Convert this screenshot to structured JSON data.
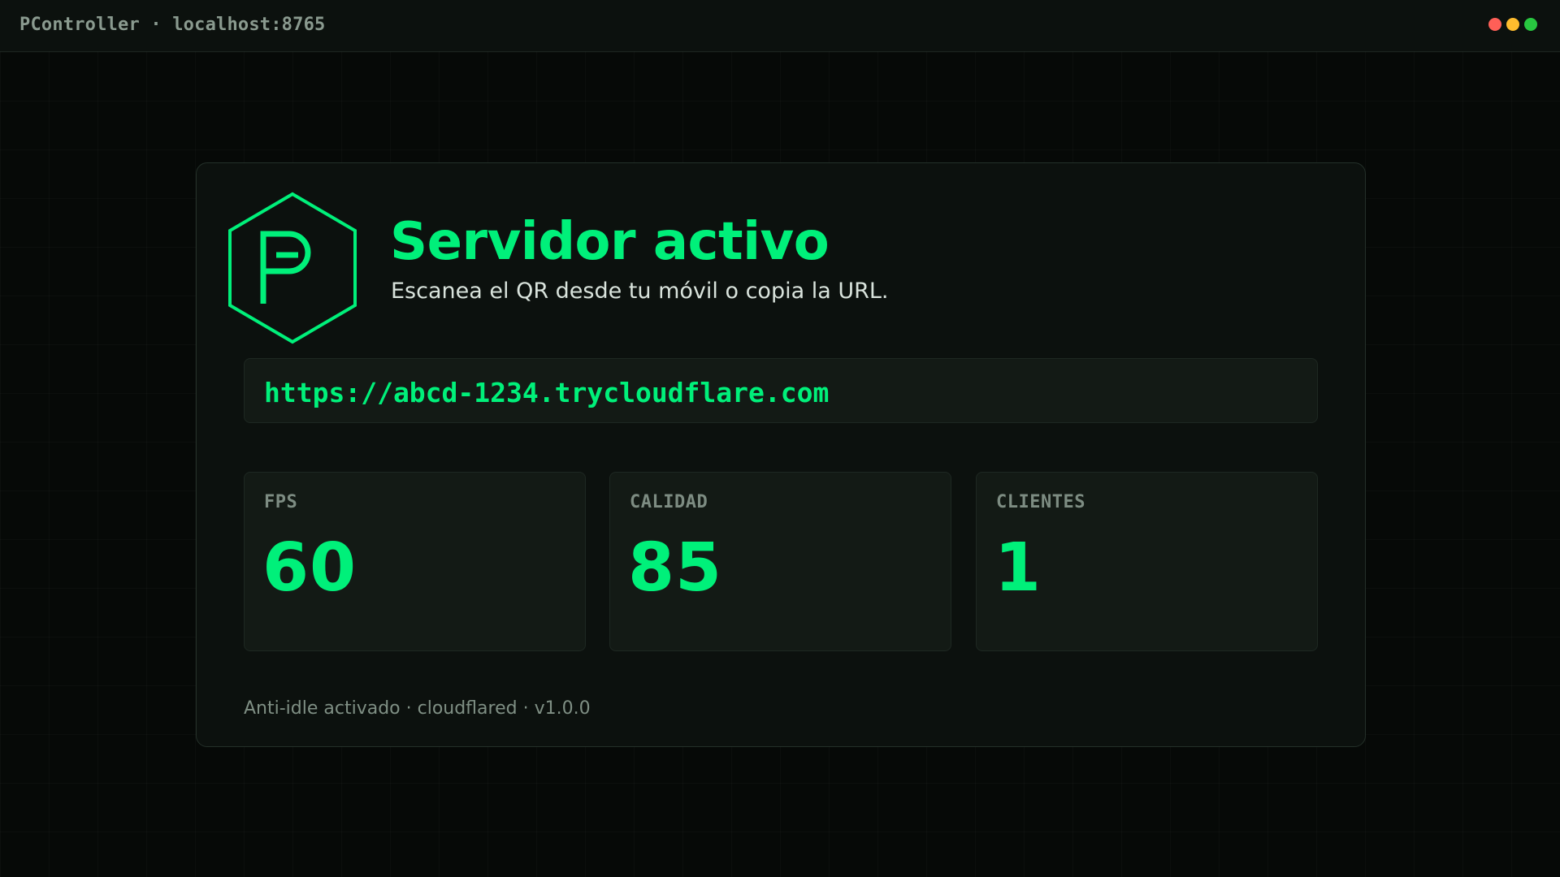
{
  "titlebar": {
    "title": "PController · localhost:8765",
    "window_controls": [
      {
        "name": "close",
        "color": "#ff5f57"
      },
      {
        "name": "minimize",
        "color": "#febc2e"
      },
      {
        "name": "maximize",
        "color": "#28c840"
      }
    ]
  },
  "logo": {
    "icon": "hexagon-p-logo-icon",
    "letter": "P"
  },
  "header": {
    "title": "Servidor activo",
    "subtitle": "Escanea el QR desde tu móvil o copia la URL."
  },
  "url": {
    "value": "https://abcd-1234.trycloudflare.com"
  },
  "stats": [
    {
      "label": "FPS",
      "value": "60"
    },
    {
      "label": "CALIDAD",
      "value": "85"
    },
    {
      "label": "CLIENTES",
      "value": "1"
    }
  ],
  "footer": {
    "text": "Anti-idle activado · cloudflared · v1.0.0"
  },
  "colors": {
    "accent": "#00f07a",
    "background": "#060907",
    "card": "#0c110e",
    "panel": "#131a15"
  }
}
